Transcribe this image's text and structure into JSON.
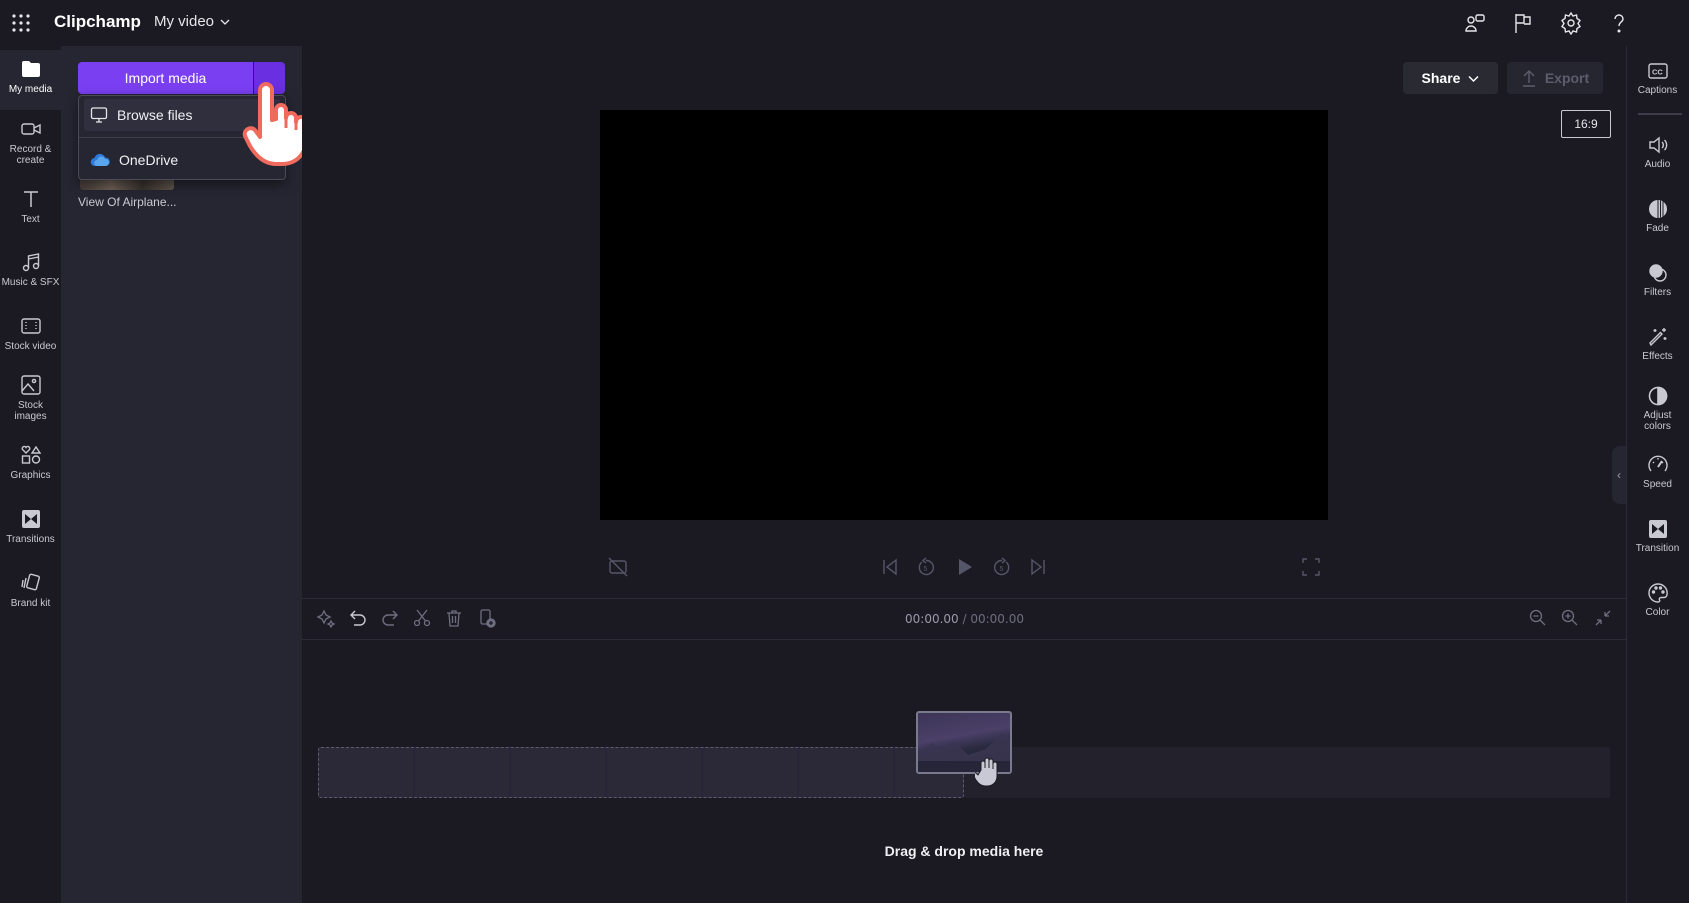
{
  "header": {
    "app_title": "Clipchamp",
    "project_title": "My video",
    "icons": [
      "apps-grid-icon",
      "feedback-icon",
      "flag-icon",
      "settings-icon",
      "help-icon"
    ]
  },
  "left_nav": {
    "items": [
      {
        "label": "My media",
        "icon": "folder-icon",
        "active": true
      },
      {
        "label": "Record & create",
        "icon": "camera-icon"
      },
      {
        "label": "Text",
        "icon": "text-icon"
      },
      {
        "label": "Music & SFX",
        "icon": "music-icon"
      },
      {
        "label": "Stock video",
        "icon": "film-icon"
      },
      {
        "label": "Stock images",
        "icon": "image-icon"
      },
      {
        "label": "Graphics",
        "icon": "shapes-icon"
      },
      {
        "label": "Transitions",
        "icon": "transition-icon"
      },
      {
        "label": "Brand kit",
        "icon": "brand-kit-icon"
      }
    ]
  },
  "media_panel": {
    "import_label": "Import media",
    "dropdown": {
      "items": [
        {
          "label": "Browse files",
          "icon": "monitor-icon"
        },
        {
          "label": "OneDrive",
          "icon": "onedrive-icon"
        }
      ]
    },
    "media_item_caption": "View Of Airplane..."
  },
  "preview": {
    "share_label": "Share",
    "export_label": "Export",
    "aspect_ratio": "16:9"
  },
  "timeline": {
    "current_time": "00:00.00",
    "separator": " / ",
    "total_time": "00:00.00",
    "drop_hint": "Drag & drop media here"
  },
  "right_nav": {
    "items": [
      {
        "label": "Captions",
        "icon": "captions-icon"
      },
      {
        "label": "Audio",
        "icon": "speaker-icon"
      },
      {
        "label": "Fade",
        "icon": "fade-icon"
      },
      {
        "label": "Filters",
        "icon": "filters-icon"
      },
      {
        "label": "Effects",
        "icon": "magic-wand-icon"
      },
      {
        "label": "Adjust colors",
        "icon": "contrast-icon"
      },
      {
        "label": "Speed",
        "icon": "speedometer-icon"
      },
      {
        "label": "Transition",
        "icon": "transition-icon"
      },
      {
        "label": "Color",
        "icon": "palette-icon"
      }
    ]
  }
}
